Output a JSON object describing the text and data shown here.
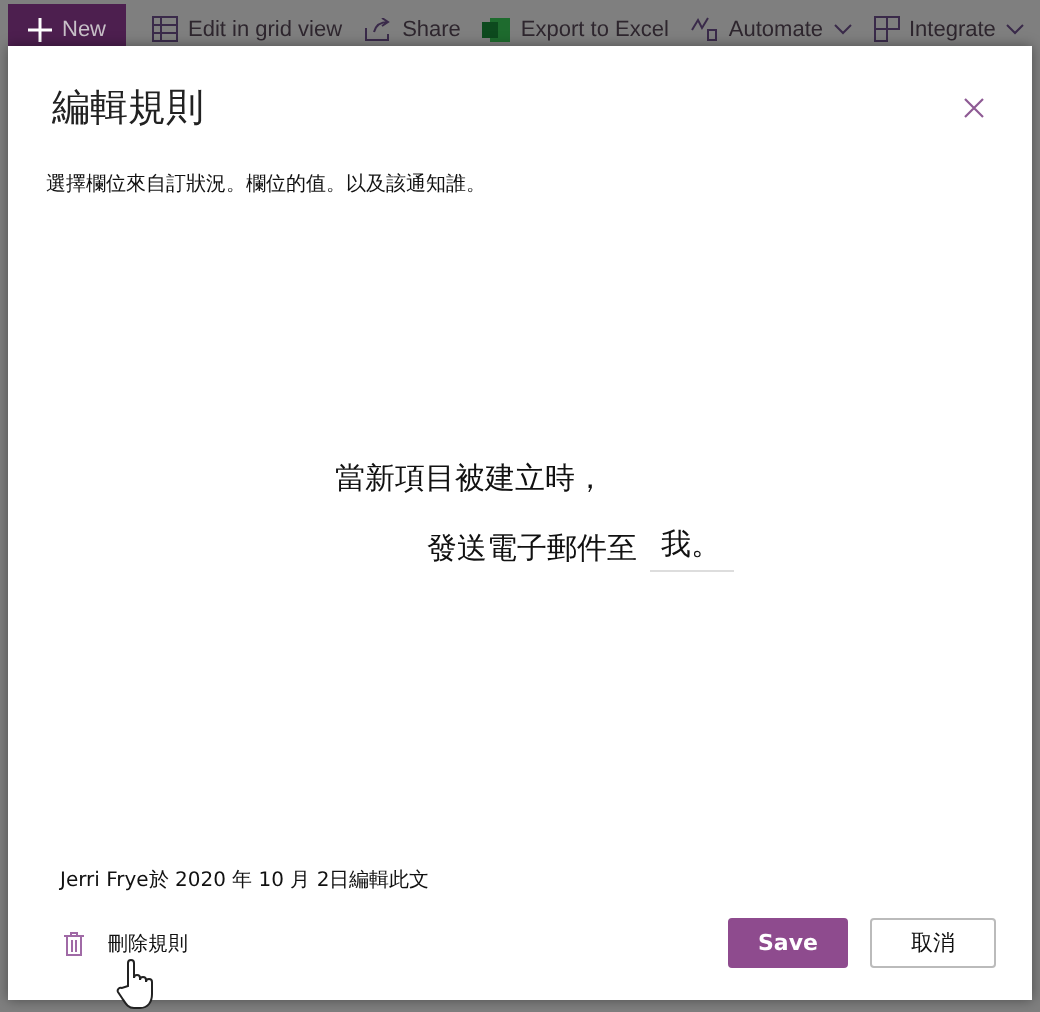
{
  "toolbar": {
    "new_button": "New",
    "items": [
      {
        "kind": "grid",
        "label": "Edit in grid view",
        "dropdown": false
      },
      {
        "kind": "share",
        "label": "Share",
        "dropdown": false
      },
      {
        "kind": "excel",
        "label": "Export to Excel",
        "dropdown": false
      },
      {
        "kind": "automate",
        "label": "Automate",
        "dropdown": true
      },
      {
        "kind": "integrate",
        "label": "Integrate",
        "dropdown": true
      }
    ]
  },
  "dialog": {
    "title": "編輯規則",
    "description": "選擇欄位來自訂狀況。欄位的值。以及該通知誰。",
    "rule": {
      "condition": "當新項目被建立時，",
      "action": "發送電子郵件至",
      "recipient": "我。"
    },
    "edited_by": "Jerri Frye於 2020 年 10 月 2日編輯此文",
    "delete_link": "刪除規則",
    "buttons": [
      {
        "kind": "primary",
        "label": "Save"
      },
      {
        "kind": "secondary",
        "label": "取消"
      }
    ]
  }
}
